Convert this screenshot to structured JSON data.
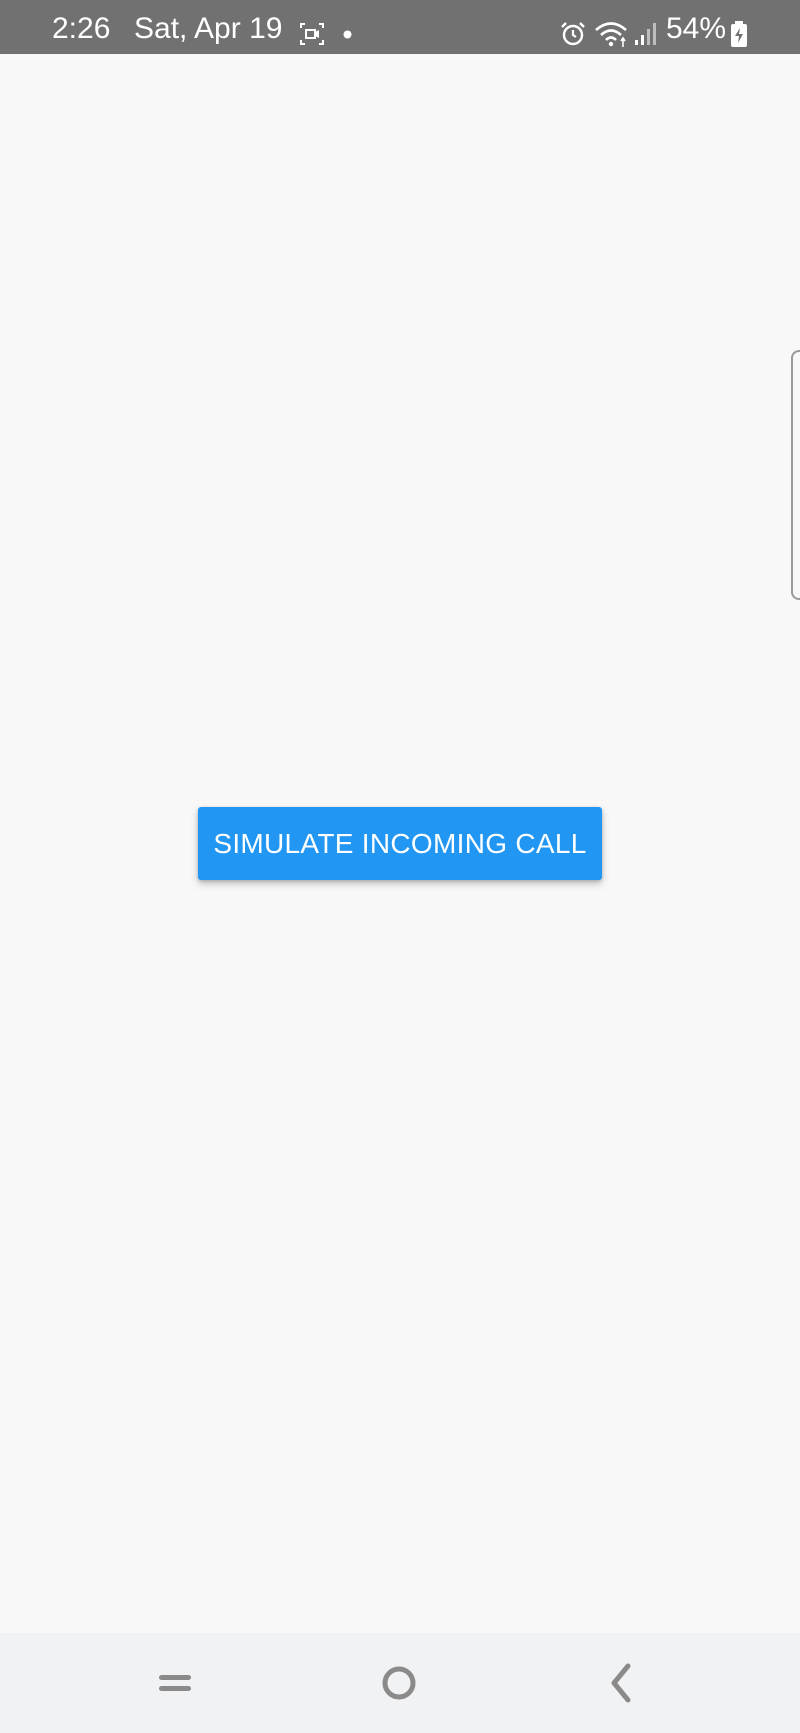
{
  "status_bar": {
    "time": "2:26",
    "date": "Sat, Apr 19",
    "battery_percent": "54%",
    "icons": [
      "screen-record-icon",
      "notification-dot-icon",
      "alarm-icon",
      "wifi-icon",
      "signal-icon",
      "battery-charging-icon"
    ],
    "background_color": "#717171"
  },
  "main": {
    "simulate_button_label": "SIMULATE INCOMING CALL",
    "button_color": "#2196f3",
    "background_color": "#f8f8f9"
  },
  "nav_bar": {
    "buttons": [
      "recent-apps-icon",
      "home-icon",
      "back-icon"
    ]
  }
}
